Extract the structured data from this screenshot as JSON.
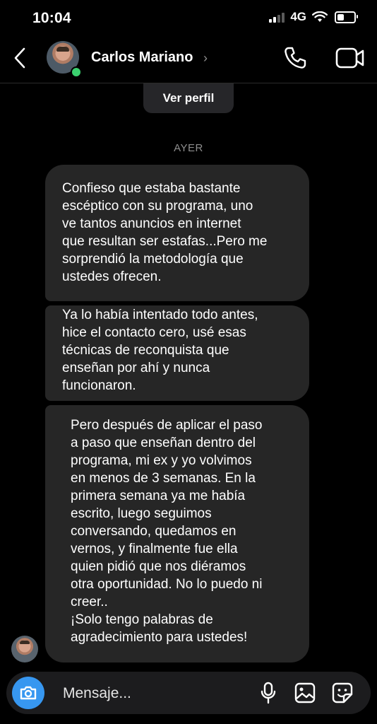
{
  "status_bar": {
    "time": "10:04",
    "network": "4G",
    "battery_level": 0.4
  },
  "header": {
    "contact_name": "Carlos Mariano",
    "chevron": "›",
    "icons": {
      "back": "chevron-left-icon",
      "call": "phone-icon",
      "video": "video-camera-icon"
    },
    "online_color": "#3bd16f"
  },
  "view_profile_label": "Ver perfil",
  "day_separator": "AYER",
  "messages": [
    {
      "lines": [
        "Confieso que estaba bastante",
        "escéptico con su programa, uno",
        "ve tantos anuncios en internet",
        "que resultan ser estafas...Pero me",
        "sorprendió la metodología que",
        "ustedes ofrecen."
      ]
    },
    {
      "lines": [
        "Ya lo había intentado todo antes,",
        "hice el contacto cero, usé esas",
        "técnicas de reconquista que",
        "enseñan por ahí y nunca",
        "funcionaron."
      ]
    },
    {
      "lines": [
        "Pero después de aplicar el paso",
        "a paso que enseñan dentro del",
        "programa, mi ex y yo volvimos",
        "en menos de 3 semanas. En la",
        "primera semana ya me había",
        "escrito, luego seguimos",
        "conversando, quedamos en",
        "vernos, y finalmente fue ella",
        "quien pidió que nos diéramos",
        "otra oportunidad. No lo puedo ni",
        "creer..",
        "¡Solo tengo palabras de",
        "agradecimiento para ustedes!"
      ]
    }
  ],
  "composer": {
    "placeholder": "Mensaje...",
    "icons": {
      "camera": "camera-icon",
      "mic": "microphone-icon",
      "gallery": "image-icon",
      "sticker": "sticker-icon"
    },
    "camera_color": "#3797f0"
  },
  "colors": {
    "background": "#000000",
    "bubble": "#262626",
    "muted_text": "#8e8e8e"
  }
}
